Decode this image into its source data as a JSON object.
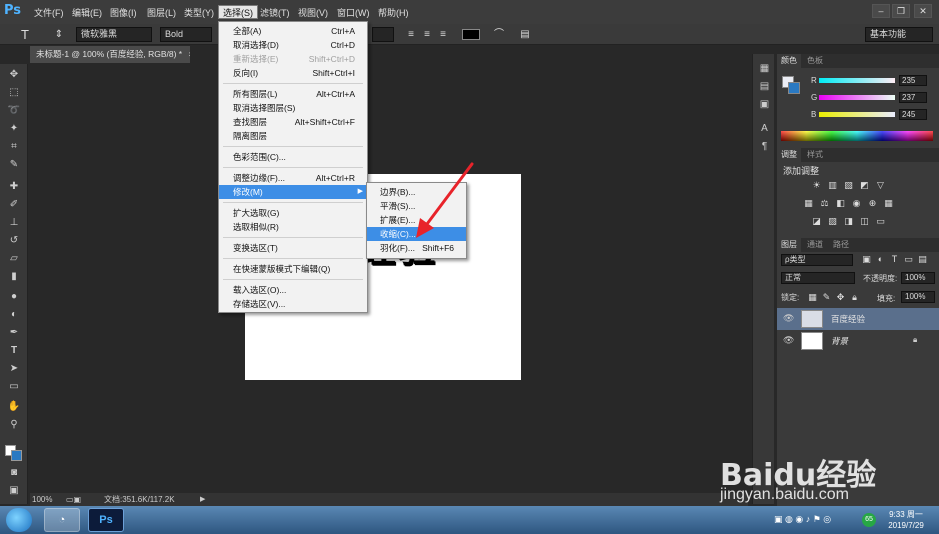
{
  "app": {
    "logo": "Ps"
  },
  "menubar": {
    "items": [
      "文件(F)",
      "编辑(E)",
      "图像(I)",
      "图层(L)",
      "类型(Y)",
      "选择(S)",
      "滤镜(T)",
      "视图(V)",
      "窗口(W)",
      "帮助(H)"
    ],
    "active": "选择(S)"
  },
  "options": {
    "font_family": "微软雅黑",
    "font_style": "Bold",
    "workspace": "基本功能"
  },
  "document": {
    "tab_title": "未标题-1 @ 100% (百度经验, RGB/8) *",
    "canvas_text": "经验",
    "close": "×"
  },
  "select_menu": {
    "items": [
      {
        "label": "全部(A)",
        "shortcut": "Ctrl+A"
      },
      {
        "label": "取消选择(D)",
        "shortcut": "Ctrl+D"
      },
      {
        "label": "重新选择(E)",
        "shortcut": "Shift+Ctrl+D"
      },
      {
        "label": "反向(I)",
        "shortcut": "Shift+Ctrl+I"
      },
      {
        "label": "所有图层(L)",
        "shortcut": "Alt+Ctrl+A"
      },
      {
        "label": "取消选择图层(S)",
        "shortcut": ""
      },
      {
        "label": "查找图层",
        "shortcut": "Alt+Shift+Ctrl+F"
      },
      {
        "label": "隔离图层",
        "shortcut": ""
      },
      {
        "label": "色彩范围(C)...",
        "shortcut": ""
      },
      {
        "label": "调整边缘(F)...",
        "shortcut": "Alt+Ctrl+R"
      },
      {
        "label": "修改(M)",
        "shortcut": ""
      },
      {
        "label": "扩大选取(G)",
        "shortcut": ""
      },
      {
        "label": "选取相似(R)",
        "shortcut": ""
      },
      {
        "label": "变换选区(T)",
        "shortcut": ""
      },
      {
        "label": "在快速蒙版模式下编辑(Q)",
        "shortcut": ""
      },
      {
        "label": "载入选区(O)...",
        "shortcut": ""
      },
      {
        "label": "存储选区(V)...",
        "shortcut": ""
      }
    ]
  },
  "modify_submenu": {
    "items": [
      {
        "label": "边界(B)...",
        "shortcut": ""
      },
      {
        "label": "平滑(S)...",
        "shortcut": ""
      },
      {
        "label": "扩展(E)...",
        "shortcut": ""
      },
      {
        "label": "收缩(C)...",
        "shortcut": ""
      },
      {
        "label": "羽化(F)...",
        "shortcut": "Shift+F6"
      }
    ],
    "highlighted": "收缩(C)..."
  },
  "color_panel": {
    "tabs": [
      "颜色",
      "色板"
    ],
    "channels": [
      {
        "label": "R",
        "value": "235"
      },
      {
        "label": "G",
        "value": "237"
      },
      {
        "label": "B",
        "value": "245"
      }
    ]
  },
  "adjust_panel": {
    "tabs": [
      "调整",
      "样式"
    ],
    "title": "添加调整"
  },
  "layers_panel": {
    "tabs": [
      "图层",
      "通道",
      "路径"
    ],
    "filter": "ρ类型",
    "blend_mode": "正常",
    "opacity_label": "不透明度:",
    "opacity_value": "100%",
    "lock_label": "锁定:",
    "fill_label": "填充:",
    "fill_value": "100%",
    "layers": [
      {
        "name": "百度经验",
        "selected": true
      },
      {
        "name": "背景",
        "selected": false
      }
    ]
  },
  "status": {
    "zoom": "100%",
    "doc_info": "文档:351.6K/117.2K"
  },
  "taskbar": {
    "ps_label": "Ps",
    "time": "9:33 周一",
    "date": "2019/7/29",
    "badge": "65"
  },
  "watermark": {
    "logo": "Baidu经验",
    "url": "jingyan.baidu.com"
  },
  "colors": {
    "highlight": "#3d8ee6",
    "background_swatch": "#2a79c2",
    "arrow": "#e8232a"
  }
}
